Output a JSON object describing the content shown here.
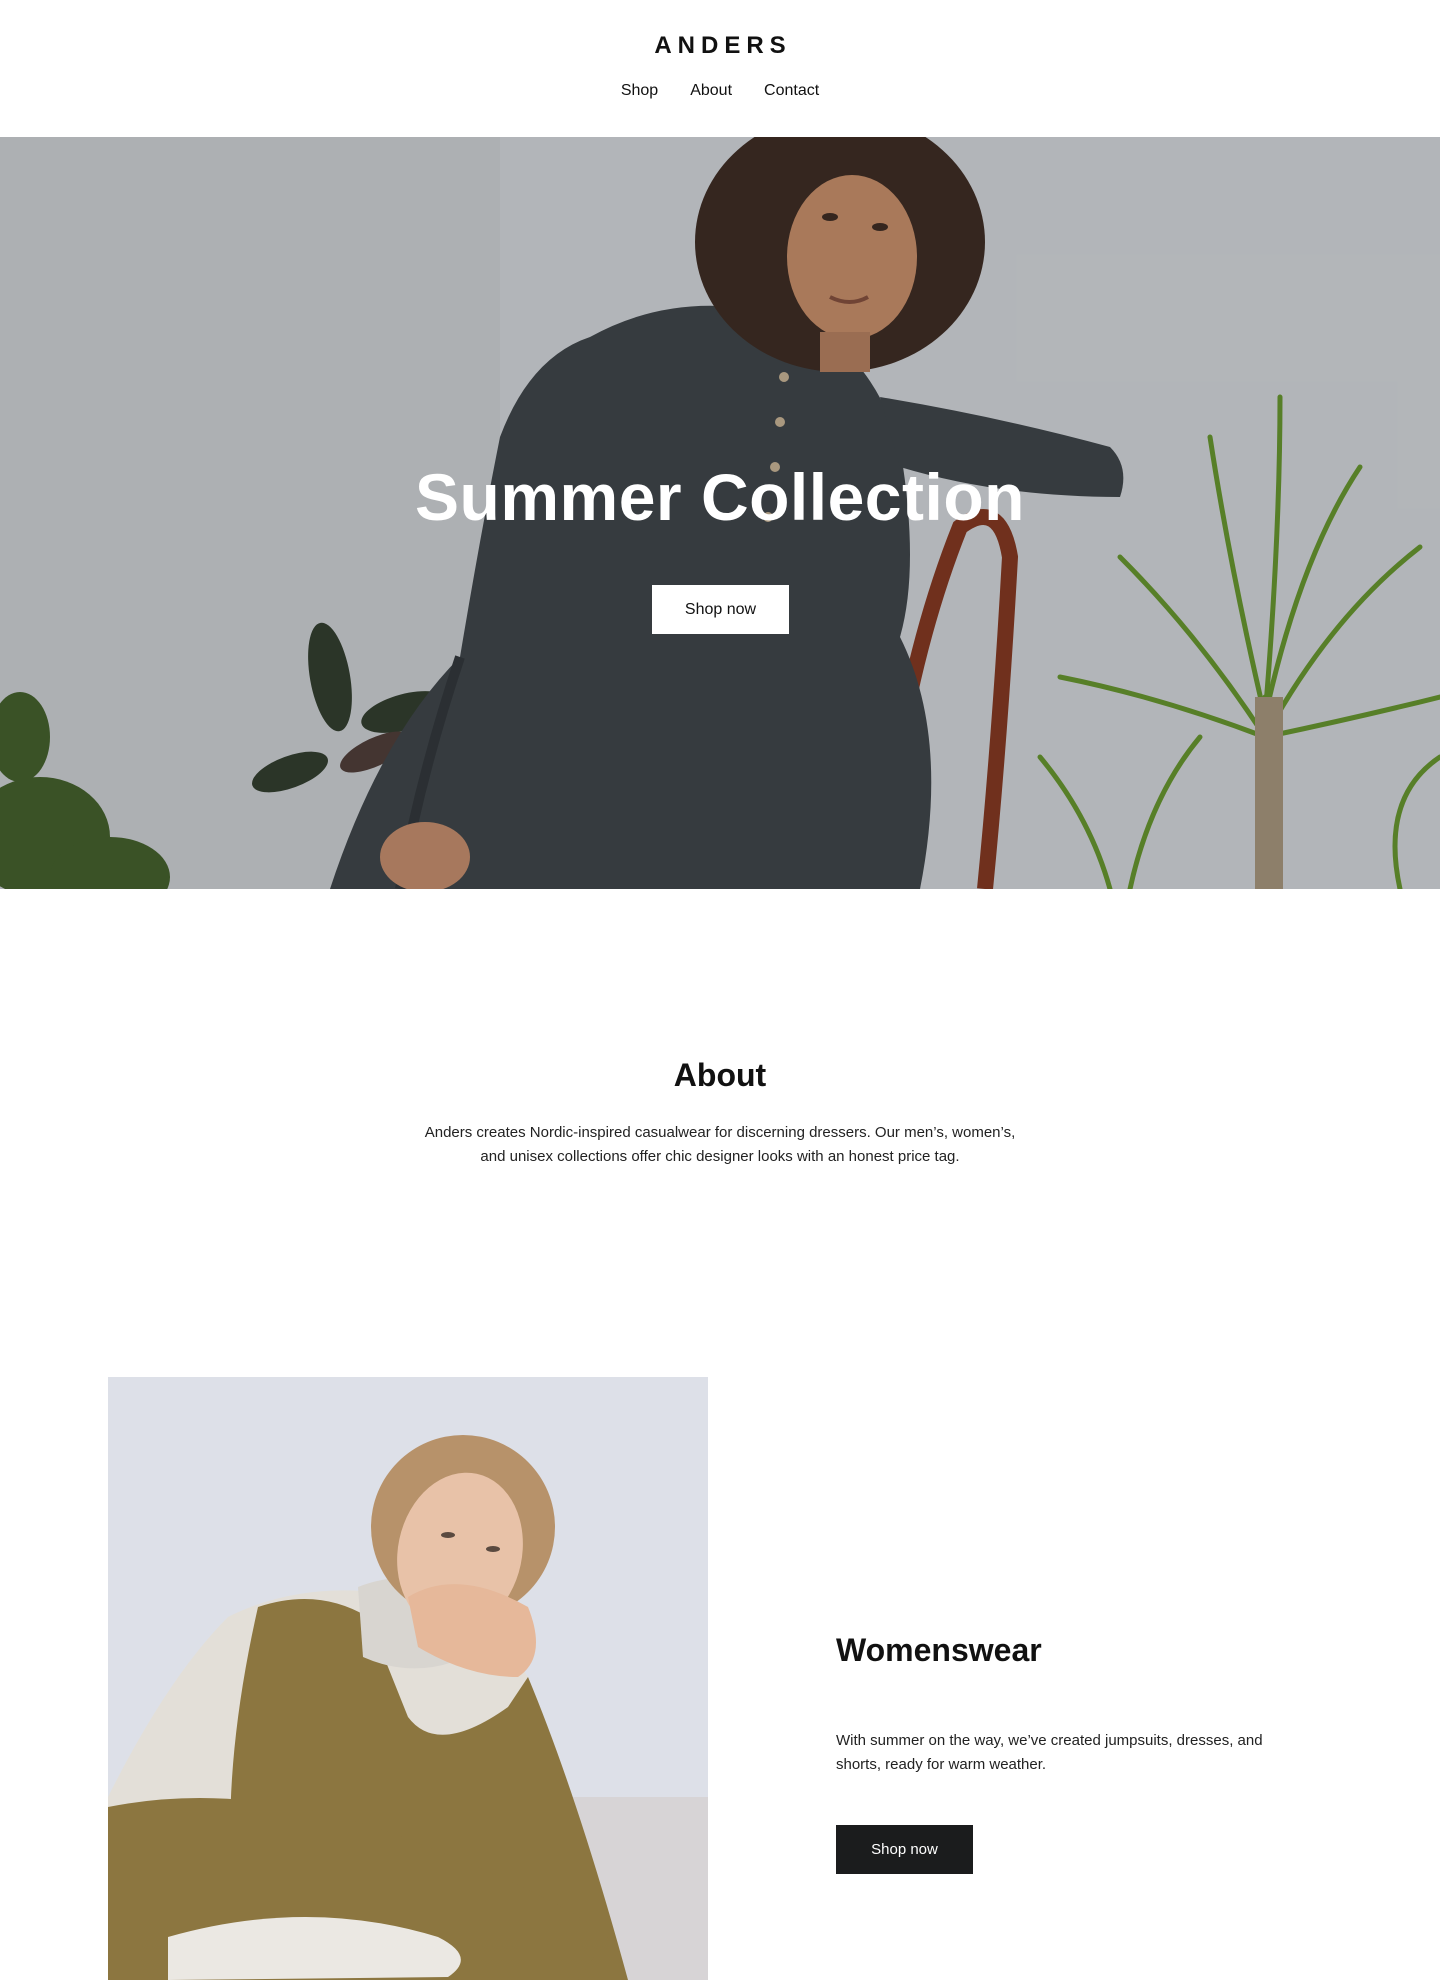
{
  "header": {
    "logo": "ANDERS",
    "nav": [
      {
        "label": "Shop"
      },
      {
        "label": "About"
      },
      {
        "label": "Contact"
      }
    ]
  },
  "hero": {
    "title": "Summer Collection",
    "button_label": "Shop now"
  },
  "about": {
    "title": "About",
    "text": "Anders creates Nordic-inspired casualwear for discerning dressers. Our men’s, women’s, and unisex collections offer chic designer looks with an honest price tag."
  },
  "womenswear": {
    "title": "Womenswear",
    "text": "With summer on the way, we’ve created jumpsuits, dresses, and shorts, ready for warm weather.",
    "button_label": "Shop now"
  },
  "colors": {
    "text": "#111111",
    "dark_button": "#1b1c1d",
    "hero_background": "#c4c7cb",
    "image_background": "#dadde5"
  }
}
